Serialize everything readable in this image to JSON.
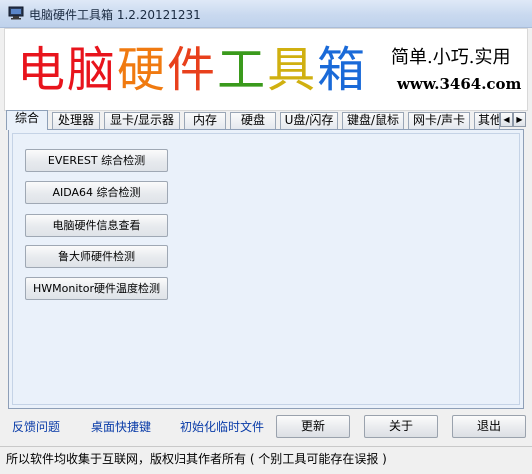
{
  "window": {
    "title": "电脑硬件工具箱 1.2.20121231",
    "icon": "computer-icon"
  },
  "banner": {
    "brand_chars": [
      {
        "char": "电",
        "color": "#e8141c"
      },
      {
        "char": "脑",
        "color": "#e8141c"
      },
      {
        "char": "硬",
        "color": "#f07a10"
      },
      {
        "char": "件",
        "color": "#e8401c"
      },
      {
        "char": "工",
        "color": "#3a9a1c"
      },
      {
        "char": "具",
        "color": "#d0b010"
      },
      {
        "char": "箱",
        "color": "#1a6ad8"
      }
    ],
    "slogan": "简单.小巧.实用",
    "website": "www.3464.com"
  },
  "tabs": [
    {
      "label": "综合",
      "active": true
    },
    {
      "label": "处理器",
      "active": false
    },
    {
      "label": "显卡/显示器",
      "active": false
    },
    {
      "label": "内存",
      "active": false
    },
    {
      "label": "硬盘",
      "active": false
    },
    {
      "label": "U盘/闪存",
      "active": false
    },
    {
      "label": "键盘/鼠标",
      "active": false
    },
    {
      "label": "网卡/声卡",
      "active": false
    },
    {
      "label": "其他",
      "active": false
    }
  ],
  "tab_scroll": {
    "left": "◀",
    "right": "▶"
  },
  "tools": [
    {
      "label": "EVEREST 综合检测"
    },
    {
      "label": "AIDA64  综合检测"
    },
    {
      "label": "电脑硬件信息查看"
    },
    {
      "label": "鲁大师硬件检测"
    },
    {
      "label": "HWMonitor硬件温度检测"
    }
  ],
  "links": {
    "feedback": "反馈问题",
    "shortcut": "桌面快捷键",
    "init_temp": "初始化临时文件"
  },
  "buttons": {
    "update": "更新",
    "about": "关于",
    "exit": "退出"
  },
  "status": "所以软件均收集于互联网，版权归其作者所有 ( 个别工具可能存在误报 )"
}
